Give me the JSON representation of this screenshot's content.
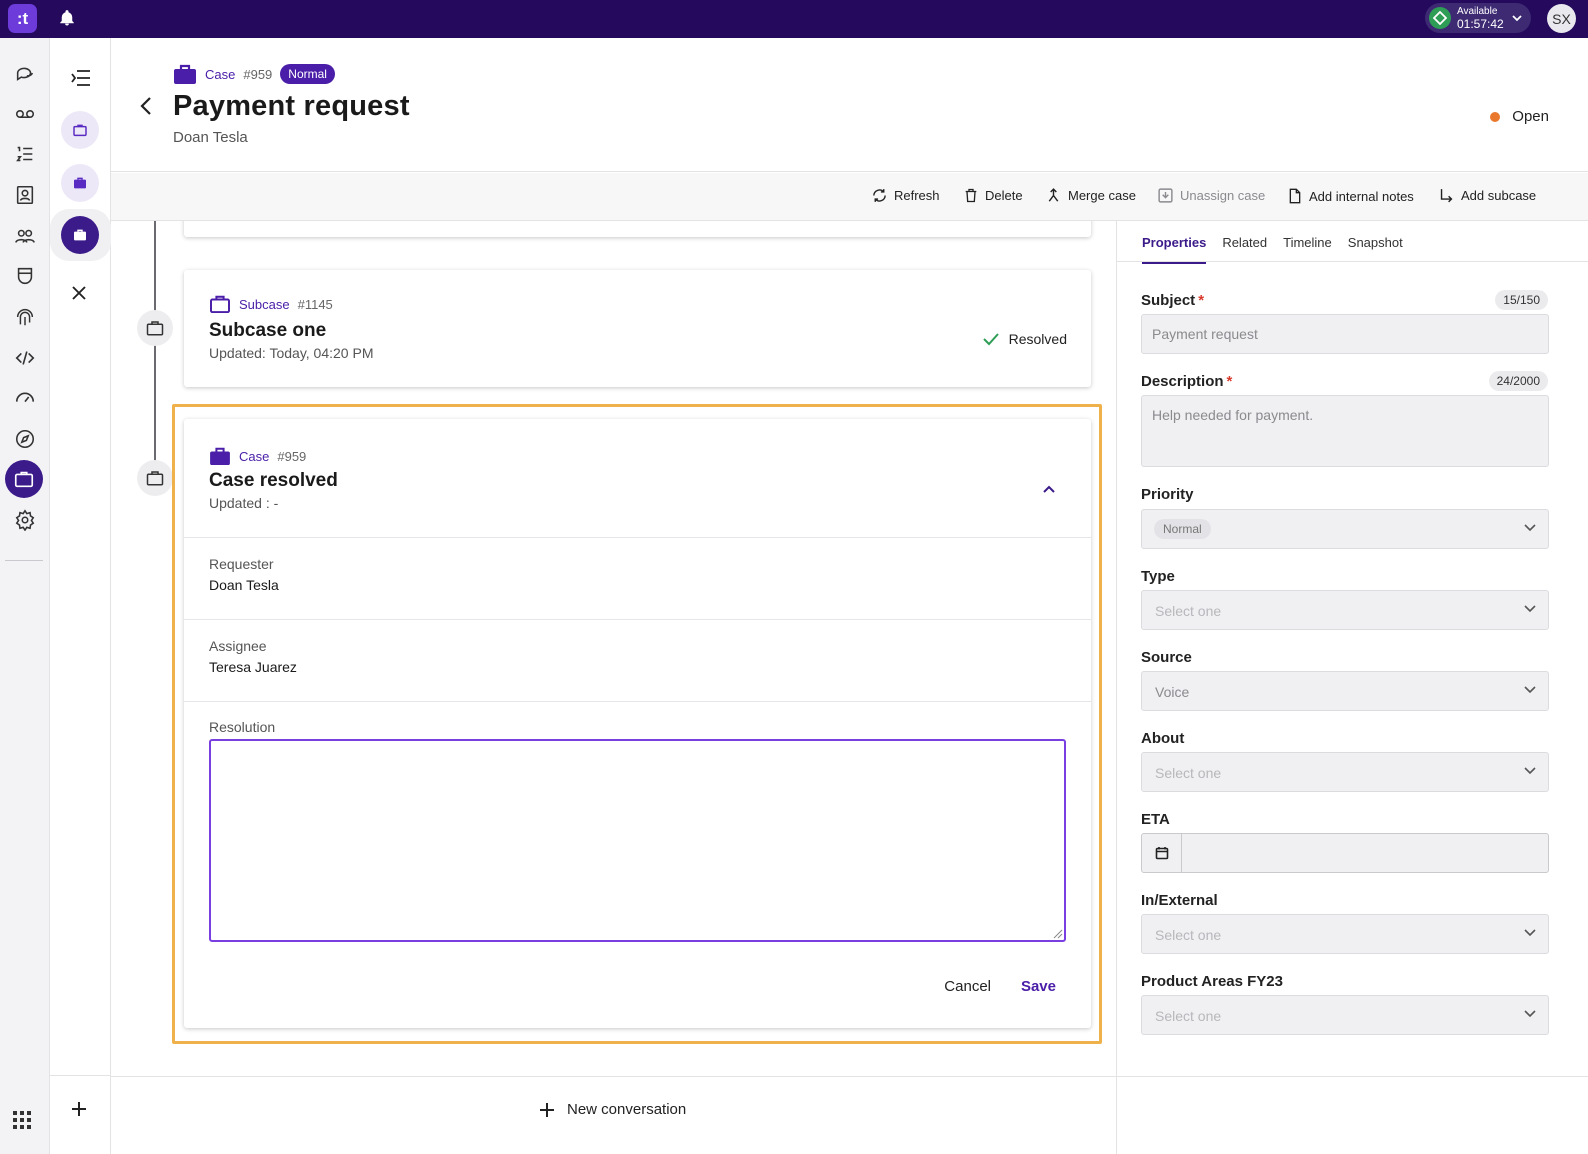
{
  "topbar": {
    "logo": ":t",
    "presence": {
      "status": "Available",
      "timer": "01:57:42"
    },
    "avatar": "SX"
  },
  "header": {
    "kicker_label": "Case",
    "case_number": "#959",
    "priority_badge": "Normal",
    "title": "Payment request",
    "requester": "Doan Tesla",
    "status": "Open"
  },
  "toolbar": {
    "refresh": "Refresh",
    "delete": "Delete",
    "merge": "Merge case",
    "unassign": "Unassign case",
    "add_notes": "Add internal notes",
    "add_subcase": "Add subcase"
  },
  "timeline": {
    "subcase": {
      "label": "Subcase",
      "number": "#1145",
      "title": "Subcase one",
      "updated": "Updated: Today, 04:20 PM",
      "status": "Resolved"
    },
    "case": {
      "label": "Case",
      "number": "#959",
      "title": "Case resolved",
      "updated": "Updated : -",
      "requester_label": "Requester",
      "requester_value": "Doan Tesla",
      "assignee_label": "Assignee",
      "assignee_value": "Teresa Juarez",
      "resolution_label": "Resolution",
      "resolution_value": "",
      "cancel": "Cancel",
      "save": "Save"
    }
  },
  "composer": {
    "new_conversation": "New conversation"
  },
  "properties": {
    "tabs": [
      "Properties",
      "Related",
      "Timeline",
      "Snapshot"
    ],
    "subject_label": "Subject",
    "subject_counter": "15/150",
    "subject_value": "Payment request",
    "description_label": "Description",
    "description_counter": "24/2000",
    "description_value": "Help needed for payment.",
    "priority_label": "Priority",
    "priority_value": "Normal",
    "type_label": "Type",
    "type_placeholder": "Select one",
    "source_label": "Source",
    "source_value": "Voice",
    "about_label": "About",
    "about_placeholder": "Select one",
    "eta_label": "ETA",
    "inext_label": "In/External",
    "inext_placeholder": "Select one",
    "product_label": "Product Areas FY23",
    "product_placeholder": "Select one"
  },
  "colors": {
    "brand": "#24095c",
    "accent": "#4a1ea8",
    "status_open": "#e9782d",
    "highlight": "#efb14a"
  }
}
